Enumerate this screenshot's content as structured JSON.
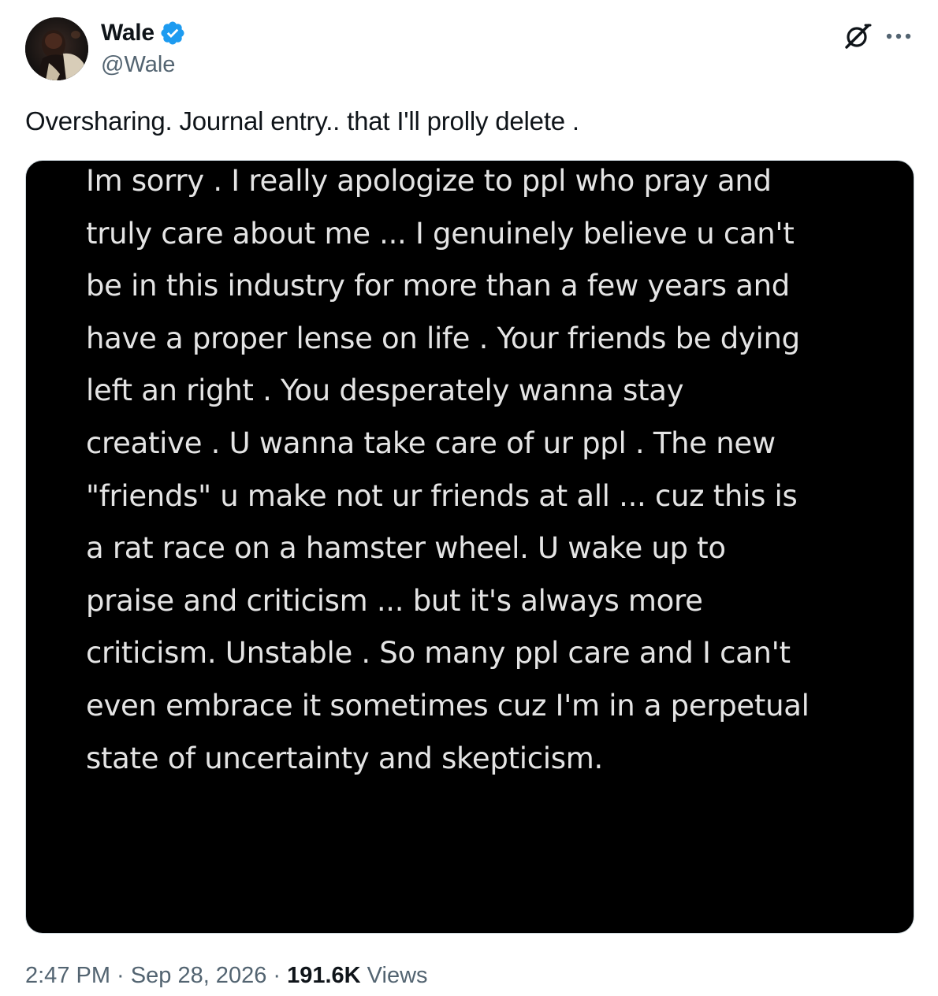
{
  "author": {
    "display_name": "Wale",
    "handle": "@Wale",
    "verified": true,
    "verified_color": "#1d9bf0"
  },
  "icons": {
    "verified": "verified-badge-icon",
    "grok": "grok-icon",
    "more": "more-options-icon"
  },
  "tweet": {
    "text": "Oversharing. Journal entry.. that I'll prolly delete ."
  },
  "media": {
    "lines": [
      "Im sorry . I really apologize to ppl who pray and",
      "truly care about me ... I genuinely believe u can't",
      "be in this industry for more than a few  years and",
      "have a proper lense on life . Your friends be dying",
      "left an right . You desperately wanna stay",
      "creative . U wanna take care of ur ppl .  The new",
      "\"friends\" u make not ur friends at all ... cuz this is",
      "a rat race on a hamster wheel. U wake up to",
      "praise and criticism ... but it's always more",
      "criticism. Unstable . So many ppl care and I can't",
      "even embrace it sometimes cuz I'm in a perpetual",
      "state of uncertainty and skepticism."
    ],
    "background": "#000000",
    "text_color": "#e4e4e4"
  },
  "meta": {
    "time": "2:47 PM",
    "separator": " · ",
    "date": "Sep 28, 2026",
    "views_count": "191.6K",
    "views_label": " Views"
  }
}
